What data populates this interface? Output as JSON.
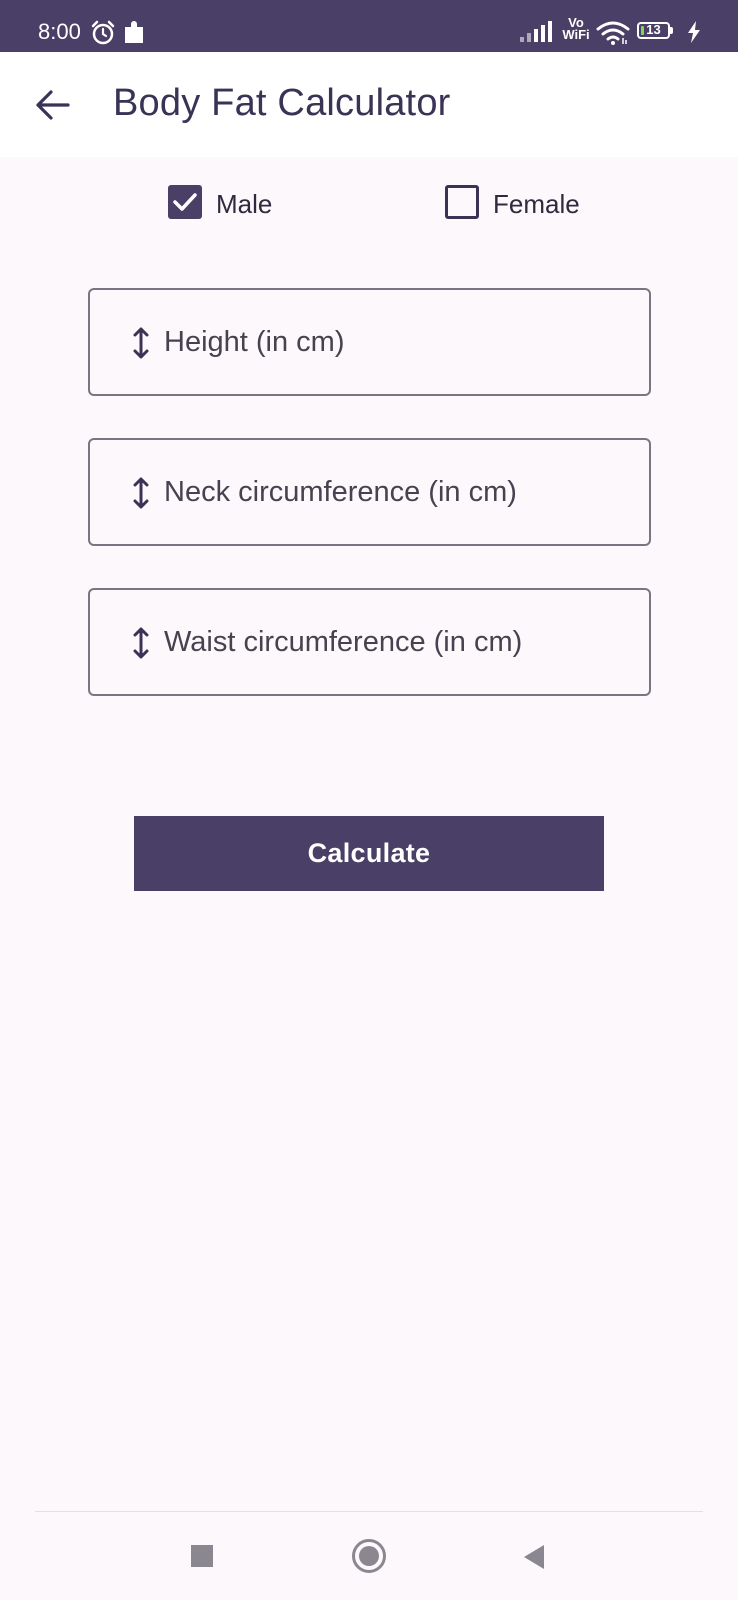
{
  "status_bar": {
    "time": "8:00",
    "network_label": "Vo WiFi",
    "battery_level": "13",
    "battery_percent": 13,
    "icons": [
      "alarm-icon",
      "puzzle-icon",
      "signal-icon",
      "wifi-icon",
      "battery-icon",
      "charging-bolt-icon"
    ]
  },
  "app_bar": {
    "title": "Body Fat Calculator",
    "back_icon": "arrow-left-icon"
  },
  "gender": {
    "male_label": "Male",
    "male_checked": true,
    "female_label": "Female",
    "female_checked": false
  },
  "fields": [
    {
      "placeholder": "Height (in cm)",
      "value": "",
      "icon": "vertical-arrows-icon"
    },
    {
      "placeholder": "Neck circumference (in cm)",
      "value": "",
      "icon": "vertical-arrows-icon"
    },
    {
      "placeholder": "Waist circumference (in cm)",
      "value": "",
      "icon": "vertical-arrows-icon"
    }
  ],
  "calculate_label": "Calculate",
  "nav_bar": {
    "icons": [
      "recents-icon",
      "home-icon",
      "back-triangle-icon"
    ]
  },
  "colors": {
    "primary": "#4a3f66",
    "background": "#fcf8fc",
    "field_border": "#7a7582"
  }
}
